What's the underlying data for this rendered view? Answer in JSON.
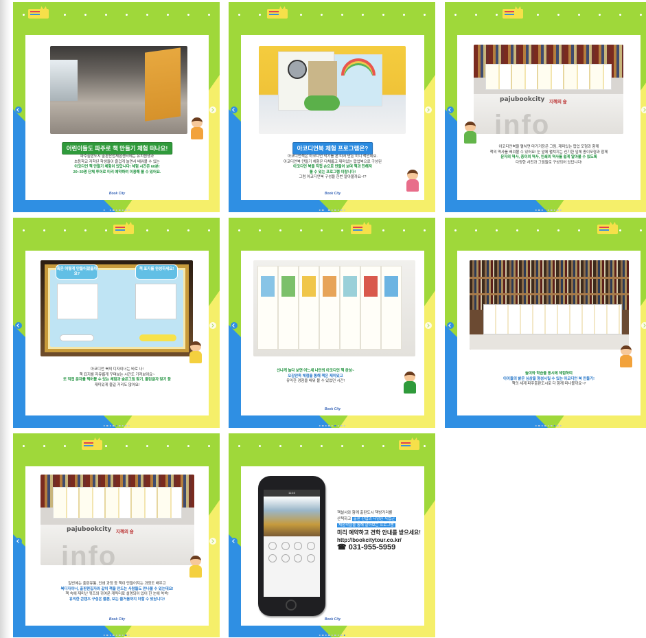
{
  "slides": [
    {
      "heading": "어린이들도 파주로 책 만들기 체험 떠나요!",
      "body": [
        "파주출판도시 출판산업체험센터에는 유치원생과",
        "초등학교 저학년 학생들이 즐겁게 놀면서 배워볼 수 있는",
        "아코디언 책 만들기 체험이 있답니다! 체험 시간은 60분!",
        "20~30명 단체 투어로 미리 예약하여 이용해 볼 수 있어요."
      ],
      "footer": "Book City",
      "page_index": 2
    },
    {
      "heading": "아코디언북 체험 프로그램은?",
      "body": [
        "아코디언책은 아코디언 악기를 본 따서 만든 미니 책인데요.",
        "아코디언북 만들기 체험은 다채롭고 재미있는 팝업북으로 구성된",
        "아코디언 북을 직접 손으로 만들어 보며 책과 친해져",
        "볼 수 있는 프로그램 이랍니다!",
        "그럼 아코디언북 구성을 한번 알아볼까요~!?"
      ],
      "footer": "Book City",
      "page_index": 3
    },
    {
      "photo_brand": "pajubookcity",
      "photo_brand2": "지혜의 숲",
      "photo_info": "info",
      "body": [
        "아코디언북을 펼치면 마가거장은 그림, 재미있는 팝업 모형과 함께",
        "책의 역사를 배워볼 수 있어요! 눈 앞에 펼쳐지는 신기한 입체 종이모형과 함께",
        "문자의 역사, 종이의 역사, 인쇄의 역사를 쉽게 알아볼 수 있도록",
        "다양한 사진과 그림들로 구성되어 있답니다!"
      ],
      "page_index": 4
    },
    {
      "tablet_q1": "혹은 어떻게 만들어졌을까요?",
      "tablet_q2": "책 표지를 완성하세요!",
      "body": [
        "아코디언 북의 디자이너는 바로 나!",
        "책 표지를 자유롭게 꾸며보는 시간도 가져보아요~",
        "또 직접 문자를 찍어볼 수 있는 체험과 숨은그림 찾기, 틀린글자 찾기 등",
        "재미있게 즐길 거리도 많아요!"
      ],
      "footer": "Book City",
      "page_index": 5
    },
    {
      "body": [
        "신나게 놀다 보면 어느새 나만의 아코디언 책 완성~",
        "오감만족 체험을 통해 책은 재미있고",
        "유익한 경험을 배워 볼 수 있었던 시간!"
      ],
      "footer": "Book City",
      "page_index": 6
    },
    {
      "body": [
        "놀이와 학습을 동시에 체험하며",
        "아이들의 밝은 심상을 형성시킬 수 있는 아코디언 북 만들기!",
        "책의 세계 파주출판도시로 다 함께 떠나볼까요~?"
      ],
      "page_index": 7
    },
    {
      "photo_brand": "pajubookcity",
      "photo_brand2": "지혜의 숲",
      "photo_info": "info",
      "body": [
        "일반에는 출판유통, 인쇄 과정 등 책이 만들어지는 과정도 배우고",
        "북디자이너, 출판편집자와 같이 책을 만드는 사람들도 만나볼 수 있는데요!",
        "책 속에 재미난 퀴즈와 귀여운 캐릭터로 설명되어 있어 한 눈에 쏙쏙!",
        "유익한 콘텐츠 구성은 물론, 보는 즐거움까지 더할 수 있답니다!"
      ],
      "footer": "Book City",
      "page_index": 8
    },
    {
      "phone_time": "11:10",
      "phone_title": "BOOKCITY TOUR",
      "contact_line1": "책설서와 함께 출판도시 책방거리를",
      "contact_line2a": "산책하고 ",
      "contact_line2b": "출판 산업의 다양한 직업군",
      "contact_line3a": "체험학습을 통해 알아보는 프로그램",
      "contact_line4": "미리 예약하고 견학 안내를 받으세요!",
      "contact_url": "http://bookcitytour.co.kr/",
      "contact_phone": "☎ 031-955-5959",
      "footer": "Book City",
      "page_index": 9
    }
  ],
  "colors": {
    "green": "#9fd83a",
    "blue": "#2f8fe3",
    "yellow": "#f5ef6a",
    "heading_green": "#2f9a3b",
    "heading_blue": "#2b8be0"
  },
  "icons": [
    "chevron-left-icon",
    "chevron-right-icon",
    "bookcity-logo-icon"
  ]
}
